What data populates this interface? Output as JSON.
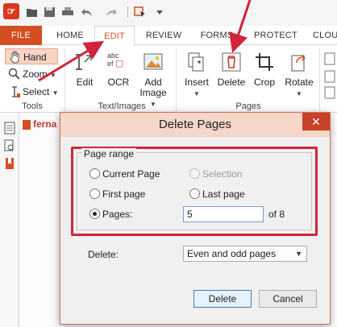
{
  "ribbon_tabs": [
    {
      "label": "FILE"
    },
    {
      "label": "HOME"
    },
    {
      "label": "EDIT"
    },
    {
      "label": "REVIEW"
    },
    {
      "label": "FORMS"
    },
    {
      "label": "PROTECT"
    },
    {
      "label": "CLOU"
    }
  ],
  "tools_group": {
    "hand": "Hand",
    "zoom": "Zoom",
    "select": "Select",
    "label": "Tools"
  },
  "text_images_group": {
    "edit": "Edit",
    "ocr": "OCR",
    "add_image_line1": "Add",
    "add_image_line2": "Image",
    "ocr_icon_text": "abc",
    "ocr_icon_text2": "ef",
    "label": "Text/Images"
  },
  "pages_group": {
    "insert": "Insert",
    "delete": "Delete",
    "crop": "Crop",
    "rotate": "Rotate",
    "label": "Pages"
  },
  "document": {
    "tab_label": "ferna"
  },
  "dialog": {
    "title": "Delete Pages",
    "close_glyph": "✕",
    "page_range_legend": "Page range",
    "options": {
      "current_page": "Current Page",
      "selection": "Selection",
      "first_page": "First page",
      "last_page": "Last page",
      "pages": "Pages:"
    },
    "selected_option": "pages",
    "pages_value": "5",
    "of_total": "of 8",
    "delete_label": "Delete:",
    "delete_select_value": "Even and odd pages",
    "delete_button": "Delete",
    "cancel_button": "Cancel"
  },
  "colors": {
    "accent": "#d54e21",
    "annotation_red": "#d0253a"
  }
}
